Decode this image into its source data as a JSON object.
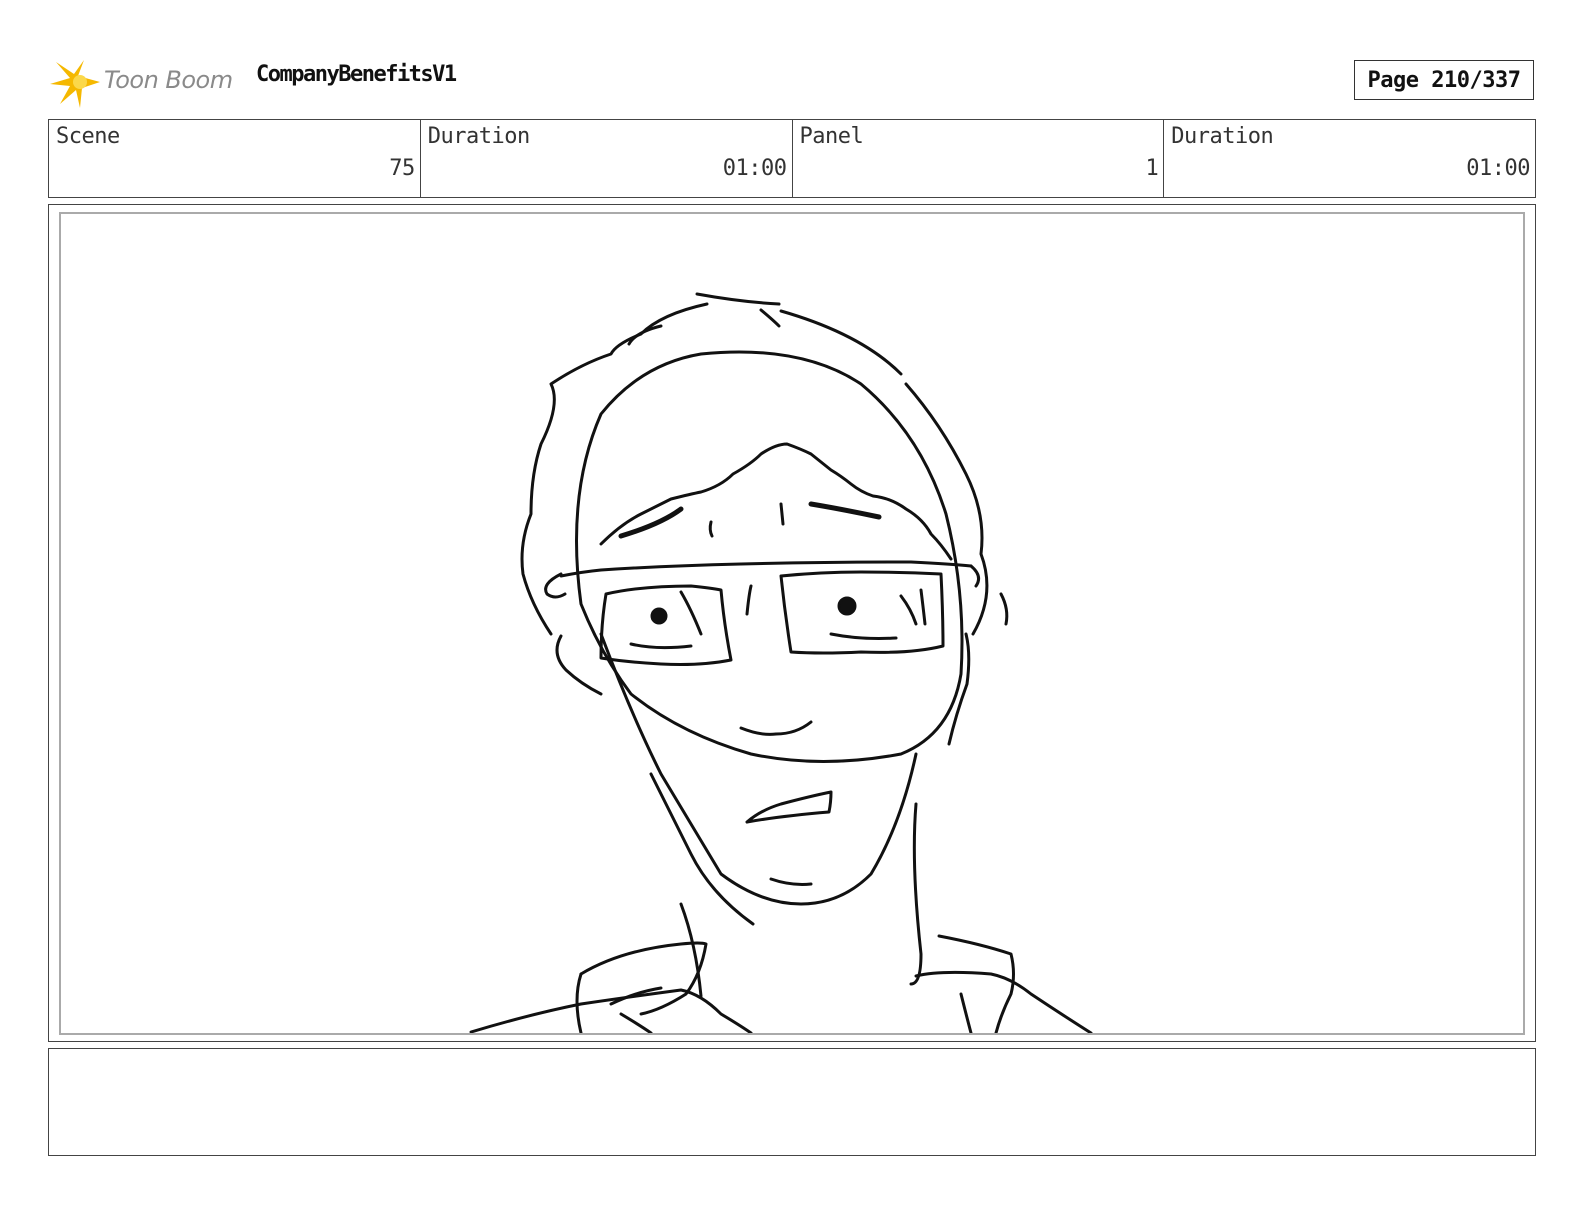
{
  "header": {
    "logo_text": "Toon Boom",
    "project_title": "CompanyBenefitsV1",
    "page_label": "Page 210/337"
  },
  "info": {
    "scene_label": "Scene",
    "scene_value": "75",
    "scene_duration_label": "Duration",
    "scene_duration_value": "01:00",
    "panel_label": "Panel",
    "panel_value": "1",
    "panel_duration_label": "Duration",
    "panel_duration_value": "01:00"
  },
  "notes": {
    "text": ""
  },
  "colors": {
    "logo_star": "#f5b800",
    "ink": "#111111"
  }
}
